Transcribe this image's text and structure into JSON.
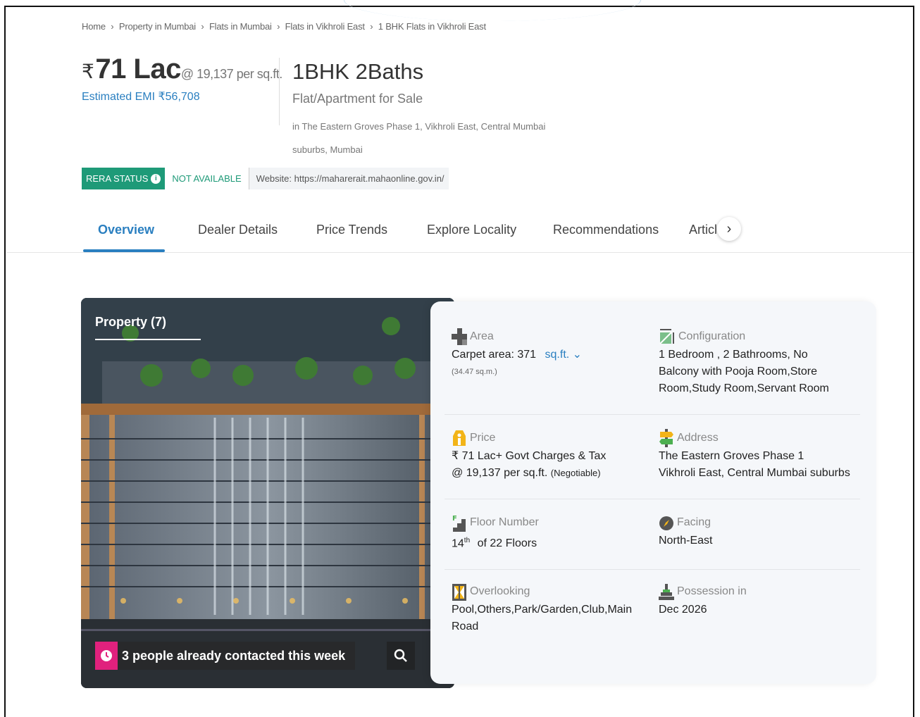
{
  "breadcrumb": [
    "Home",
    "Property in Mumbai",
    "Flats in Mumbai",
    "Flats in Vikhroli East",
    "1 BHK Flats in Vikhroli East"
  ],
  "price": {
    "rupee_symbol": "₹",
    "amount": "71 Lac",
    "per_sqft": "@ 19,137 per sq.ft.",
    "emi": "Estimated EMI ₹56,708"
  },
  "title": {
    "main": "1BHK 2Baths",
    "sub": "Flat/Apartment for Sale",
    "location": "in The Eastern Groves Phase 1, Vikhroli East, Central Mumbai suburbs, Mumbai"
  },
  "rera": {
    "status_label": "RERA STATUS",
    "status_value": "NOT AVAILABLE",
    "website": "Website: https://maharerait.mahaonline.gov.in/"
  },
  "tabs": [
    "Overview",
    "Dealer Details",
    "Price Trends",
    "Explore Locality",
    "Recommendations",
    "Article"
  ],
  "photo": {
    "label": "Property (7)",
    "contacted": "3 people already contacted this week"
  },
  "details": {
    "area": {
      "label": "Area",
      "value": "Carpet area: 371",
      "unit": "sq.ft.",
      "sub": "(34.47 sq.m.)"
    },
    "configuration": {
      "label": "Configuration",
      "value": "1 Bedroom , 2 Bathrooms, No Balcony with Pooja Room,Store Room,Study Room,Servant Room"
    },
    "price": {
      "label": "Price",
      "line1": "₹ 71 Lac+ Govt Charges & Tax",
      "line2": "@ 19,137 per sq.ft.",
      "note": "(Negotiable)"
    },
    "address": {
      "label": "Address",
      "line1": "The Eastern Groves Phase 1",
      "line2": "Vikhroli East, Central Mumbai suburbs"
    },
    "floor": {
      "label": "Floor Number",
      "num": "14",
      "sup": "th",
      "rest": "of 22 Floors"
    },
    "facing": {
      "label": "Facing",
      "value": "North-East"
    },
    "overlooking": {
      "label": "Overlooking",
      "value": "Pool,Others,Park/Garden,Club,Main Road"
    },
    "possession": {
      "label": "Possession in",
      "value": "Dec 2026"
    }
  },
  "colors": {
    "accent": "#2a7fc0",
    "rera": "#1e9a78",
    "contact_pin": "#e0217d"
  }
}
